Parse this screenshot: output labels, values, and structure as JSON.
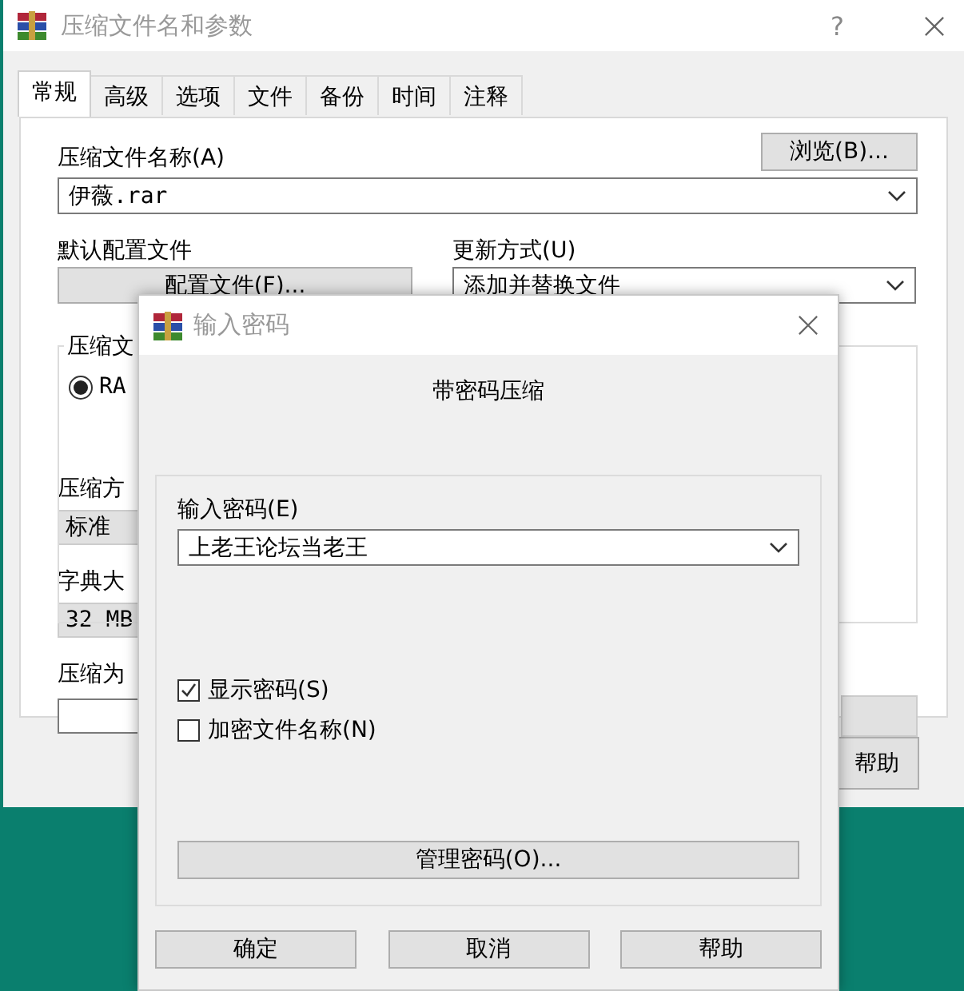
{
  "main_window": {
    "title": "压缩文件名和参数",
    "help_icon": "?",
    "tabs": [
      {
        "label": "常规",
        "selected": true
      },
      {
        "label": "高级",
        "selected": false
      },
      {
        "label": "选项",
        "selected": false
      },
      {
        "label": "文件",
        "selected": false
      },
      {
        "label": "备份",
        "selected": false
      },
      {
        "label": "时间",
        "selected": false
      },
      {
        "label": "注释",
        "selected": false
      }
    ],
    "archive_name_label": "压缩文件名称(A)",
    "browse_button": "浏览(B)...",
    "archive_name": "伊薇.rar",
    "profile_label": "默认配置文件",
    "profile_button": "配置文件(F)...",
    "update_label": "更新方式(U)",
    "update_mode": "添加并替换文件",
    "format_group_label": "压缩文",
    "format_radio": {
      "label": "RA",
      "selected": true
    },
    "method_label": "压缩方",
    "method": "标准",
    "dictionary_label": "字典大",
    "dictionary": "32 MB",
    "split_label": "压缩为",
    "buttons": [
      "帮助"
    ]
  },
  "password_dialog": {
    "title": "输入密码",
    "heading": "带密码压缩",
    "password_label": "输入密码(E)",
    "password": "上老王论坛当老王",
    "checkboxes": [
      {
        "label": "显示密码(S)",
        "checked": true
      },
      {
        "label": "加密文件名称(N)",
        "checked": false
      }
    ],
    "manage_button": "管理密码(O)...",
    "buttons": [
      "确定",
      "取消",
      "帮助"
    ]
  }
}
